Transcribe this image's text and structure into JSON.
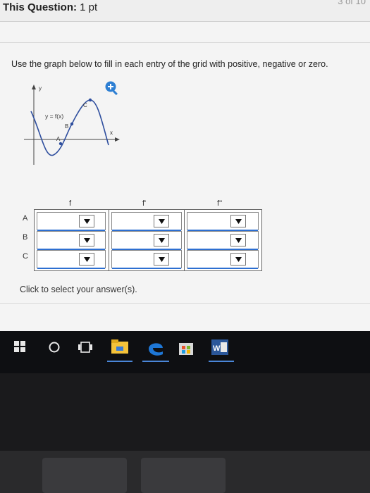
{
  "header": {
    "question_label": "This Question:",
    "points": "1 pt",
    "counter": "3 of 10"
  },
  "question": {
    "instruction": "Use the graph below to fill in each entry of the grid with positive, negative or zero.",
    "graph": {
      "y_axis_label": "y",
      "x_axis_label": "x",
      "function_label": "y = f(x)",
      "points": [
        "A",
        "B",
        "C"
      ]
    },
    "grid": {
      "columns": [
        "f",
        "f'",
        "f''"
      ],
      "rows": [
        "A",
        "B",
        "C"
      ]
    },
    "footer_text": "Click to select your answer(s)."
  },
  "taskbar": {
    "icons": [
      "windows-start-icon",
      "cortana-icon",
      "task-view-icon",
      "file-explorer-icon",
      "edge-icon",
      "store-icon",
      "word-icon"
    ]
  },
  "colors": {
    "accent": "#2d6fd1",
    "page_bg": "#f4f4f4",
    "taskbar_bg": "#0e0f12",
    "edge_blue": "#1e77d6",
    "explorer_yellow": "#f4c23a",
    "word_blue": "#2b579a"
  }
}
